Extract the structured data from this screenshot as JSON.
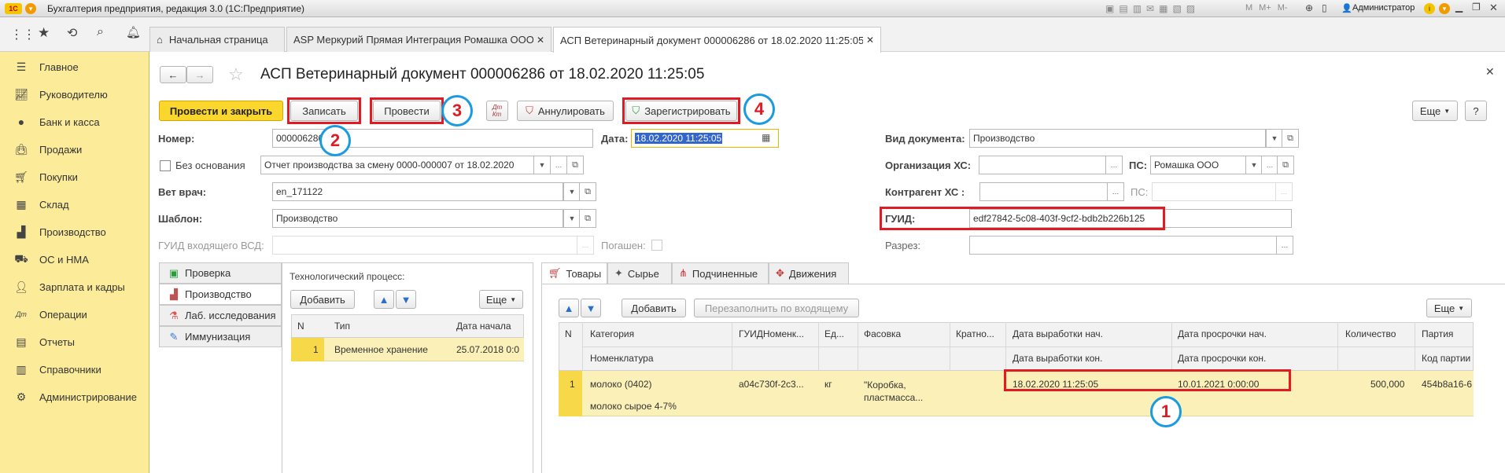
{
  "window": {
    "title": "Бухгалтерия предприятия, редакция 3.0  (1С:Предприятие)",
    "user": "Администратор",
    "mem_labels": [
      "M",
      "M+",
      "M-"
    ]
  },
  "tabs": [
    {
      "label": "Начальная страница"
    },
    {
      "label": "ASP Меркурий Прямая Интеграция Ромашка ООО"
    },
    {
      "label": "АСП Ветеринарный документ 000006286 от 18.02.2020 11:25:05"
    }
  ],
  "sidebar": {
    "items": [
      {
        "label": "Главное",
        "icon": "menu-icon"
      },
      {
        "label": "Руководителю",
        "icon": "chart-icon"
      },
      {
        "label": "Банк и касса",
        "icon": "coin-icon"
      },
      {
        "label": "Продажи",
        "icon": "bag-icon"
      },
      {
        "label": "Покупки",
        "icon": "cart-icon"
      },
      {
        "label": "Склад",
        "icon": "warehouse-icon"
      },
      {
        "label": "Производство",
        "icon": "factory-icon"
      },
      {
        "label": "ОС и НМА",
        "icon": "truck-icon"
      },
      {
        "label": "Зарплата и кадры",
        "icon": "person-icon"
      },
      {
        "label": "Операции",
        "icon": "dt-kt-icon"
      },
      {
        "label": "Отчеты",
        "icon": "report-icon"
      },
      {
        "label": "Справочники",
        "icon": "book-icon"
      },
      {
        "label": "Администрирование",
        "icon": "gear-icon"
      }
    ]
  },
  "form": {
    "title": "АСП Ветеринарный документ 000006286 от 18.02.2020 11:25:05",
    "buttons": {
      "post_close": "Провести и закрыть",
      "write": "Записать",
      "post": "Провести",
      "annul": "Аннулировать",
      "register": "Зарегистрировать",
      "more": "Еще",
      "help": "?"
    },
    "number_label": "Номер:",
    "number_value": "000006286",
    "date_label": "Дата:",
    "date_value": "18.02.2020 11:25:05",
    "no_basis_label": "Без основания",
    "basis_value": "Отчет производства за смену 0000-000007 от 18.02.2020",
    "vet_label": "Вет врач:",
    "vet_value": "en_171122",
    "template_label": "Шаблон:",
    "template_value": "Производство",
    "guid_in_label": "ГУИД входящего ВСД:",
    "redeemed_label": "Погашен:",
    "doctype_label": "Вид документа:",
    "doctype_value": "Производство",
    "org_label": "Организация ХС:",
    "org_value": "",
    "ps_label": "ПС:",
    "ps_value": "Ромашка ООО",
    "contr_label": "Контрагент ХС   :",
    "contr_value": "",
    "ps2_label": "ПС:",
    "guid_label": "ГУИД:",
    "guid_value": "edf27842-5c08-403f-9cf2-bdb2b226b125",
    "razrez_label": "Разрез:"
  },
  "left_tabs": [
    {
      "label": "Проверка"
    },
    {
      "label": "Производство"
    },
    {
      "label": "Лаб. исследования"
    },
    {
      "label": "Иммунизация"
    }
  ],
  "tech": {
    "title": "Технологический процесс:",
    "add": "Добавить",
    "more": "Еще",
    "columns": [
      "N",
      "Тип",
      "Дата начала"
    ],
    "rows": [
      {
        "n": "1",
        "type": "Временное хранение",
        "date": "25.07.2018 0:0"
      }
    ]
  },
  "right_tabs": [
    {
      "label": "Товары"
    },
    {
      "label": "Сырье"
    },
    {
      "label": "Подчиненные"
    },
    {
      "label": "Движения"
    }
  ],
  "goods": {
    "add": "Добавить",
    "refill": "Перезаполнить по входящему",
    "more": "Еще",
    "columns_top": [
      "N",
      "Категория",
      "ГУИДНоменк...",
      "Ед...",
      "Фасовка",
      "Кратно...",
      "Дата выработки нач.",
      "Дата просрочки нач.",
      "Количество",
      "Партия"
    ],
    "columns_bottom": [
      "Номенклатура",
      "Дата выработки кон.",
      "Дата просрочки кон.",
      "Код партии"
    ],
    "row": {
      "n": "1",
      "category": "молоко (0402)",
      "nomenclature": "молоко сырое 4-7%",
      "guid": "a04c730f-2c3...",
      "unit": "кг",
      "pack": "\"Коробка, пластмасса...",
      "prod_start": "18.02.2020 11:25:05",
      "exp_start": "10.01.2021 0:00:00",
      "qty": "500,000",
      "batch": "454b8a16-6"
    }
  },
  "annotations": [
    "1",
    "2",
    "3",
    "4"
  ]
}
